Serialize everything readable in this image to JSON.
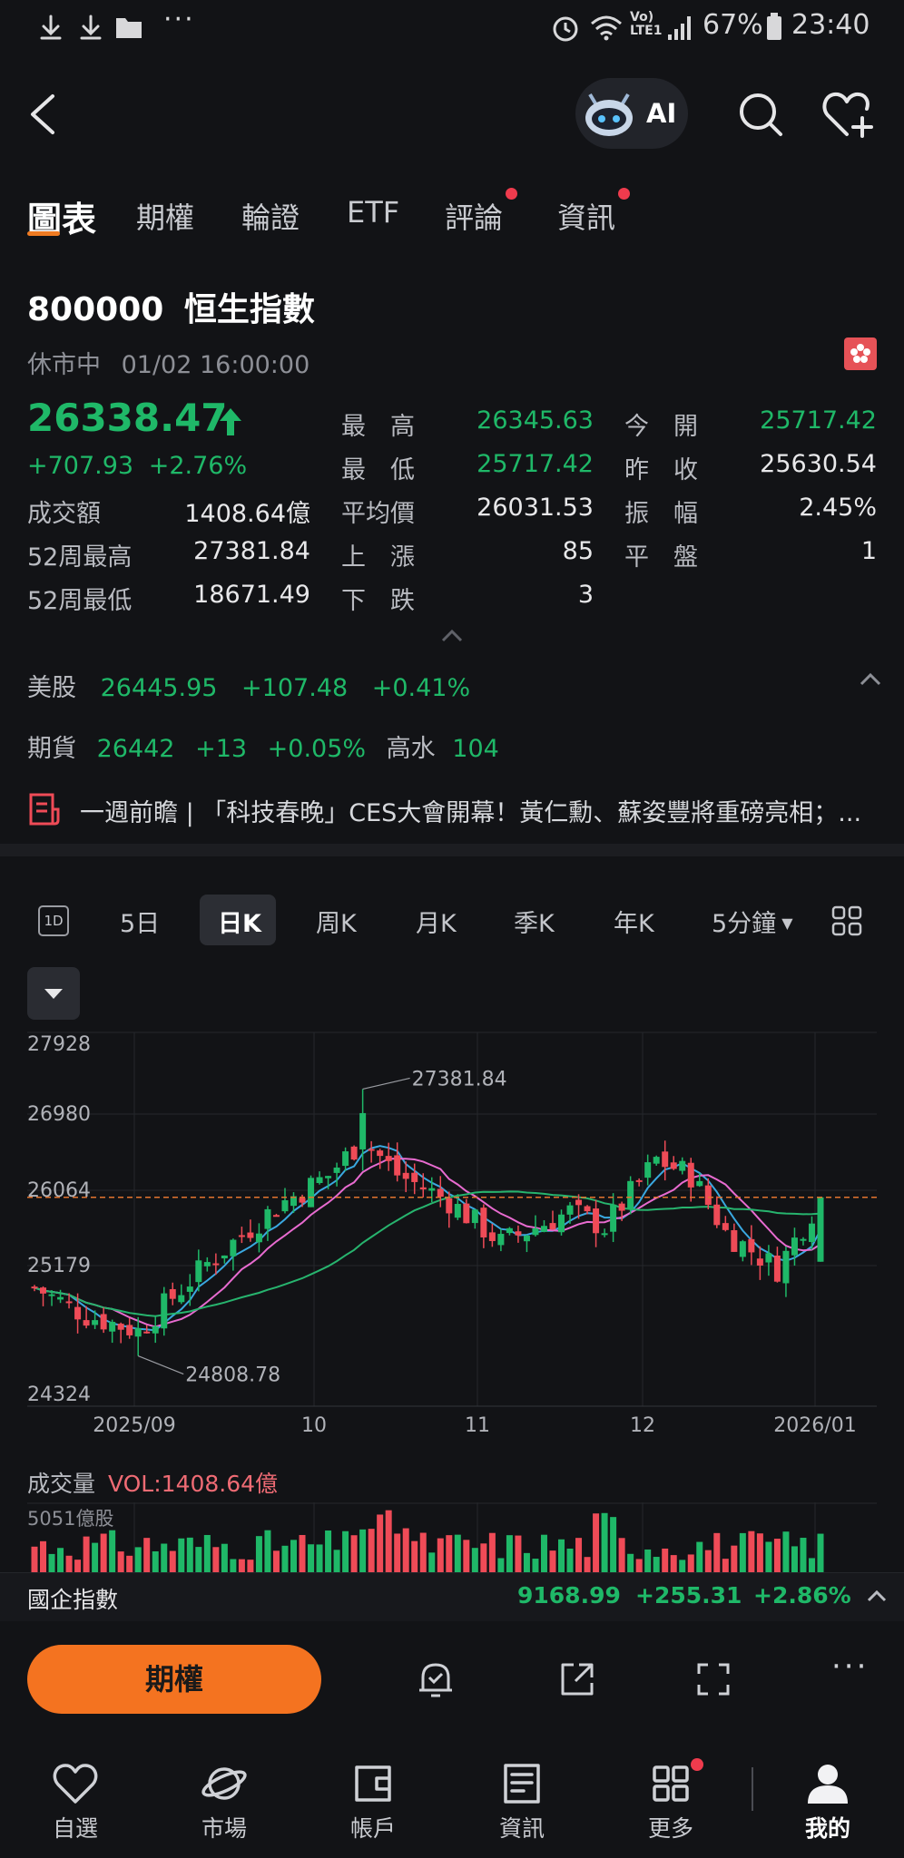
{
  "status_bar": {
    "signal_label_top": "Vo)",
    "signal_label_bottom": "LTE1",
    "battery": "67%",
    "time": "23:40"
  },
  "header": {
    "ai_label": "AI"
  },
  "tabs": [
    {
      "label": "圖表",
      "active": true,
      "dot": false
    },
    {
      "label": "期權",
      "active": false,
      "dot": false
    },
    {
      "label": "輪證",
      "active": false,
      "dot": false
    },
    {
      "label": "ETF",
      "active": false,
      "dot": false
    },
    {
      "label": "評論",
      "active": false,
      "dot": true
    },
    {
      "label": "資訊",
      "active": false,
      "dot": true
    }
  ],
  "stock": {
    "code": "800000",
    "name": "恒生指數",
    "status": "休市中",
    "datetime": "01/02 16:00:00",
    "price": "26338.47",
    "change": "+707.93",
    "change_pct": "+2.76%"
  },
  "quote": {
    "high_label": "最　高",
    "high": "26345.63",
    "open_label": "今　開",
    "open": "25717.42",
    "low_label": "最　低",
    "low": "25717.42",
    "prev_close_label": "昨　收",
    "prev_close": "25630.54",
    "turnover_label": "成交額",
    "turnover": "1408.64億",
    "avg_label": "平均價",
    "avg": "26031.53",
    "amplitude_label": "振　幅",
    "amplitude": "2.45%",
    "wk52_high_label": "52周最高",
    "wk52_high": "27381.84",
    "up_label": "上　漲",
    "up": "85",
    "flat_label": "平　盤",
    "flat": "1",
    "wk52_low_label": "52周最低",
    "wk52_low": "18671.49",
    "down_label": "下　跌",
    "down": "3"
  },
  "related": {
    "us_label": "美股",
    "us_price": "26445.95",
    "us_change": "+107.48",
    "us_pct": "+0.41%",
    "fut_label": "期貨",
    "fut_price": "26442",
    "fut_change": "+13",
    "fut_pct": "+0.05%",
    "premium_label": "高水",
    "premium": "104"
  },
  "news_headline": "一週前瞻 | 「科技春晚」CES大會開幕！黃仁勳、蘇姿豐將重磅亮相；...",
  "chart_toolbar": {
    "one_day": "1D",
    "items": [
      "5日",
      "日K",
      "周K",
      "月K",
      "季K",
      "年K"
    ],
    "active": "日K",
    "interval": "5分鐘"
  },
  "chart_data": {
    "type": "candlestick",
    "y_ticks": [
      "27928",
      "26980",
      "26064",
      "25179",
      "24324"
    ],
    "x_ticks": [
      "2025/09",
      "10",
      "11",
      "12",
      "2026/01"
    ],
    "ylim": [
      24324,
      27928
    ],
    "max_label": "27381.84",
    "min_label": "24808.78",
    "last_close": 26338.47,
    "up_color": "#1fb868",
    "down_color": "#ef4b57",
    "ma_colors": [
      "#3aa8e0",
      "#e86bd0",
      "#27b46e"
    ]
  },
  "volume": {
    "label": "成交量",
    "vol_text": "VOL:1408.64億",
    "max_label": "5051億股"
  },
  "mini_bar": {
    "name": "國企指數",
    "price": "9168.99",
    "change": "+255.31",
    "pct": "+2.86%"
  },
  "actions": {
    "options_button": "期權"
  },
  "bottom_nav": [
    {
      "label": "自選",
      "icon": "heart"
    },
    {
      "label": "市場",
      "icon": "planet"
    },
    {
      "label": "帳戶",
      "icon": "wallet"
    },
    {
      "label": "資訊",
      "icon": "news"
    },
    {
      "label": "更多",
      "icon": "grid"
    },
    {
      "label": "我的",
      "icon": "person"
    }
  ]
}
